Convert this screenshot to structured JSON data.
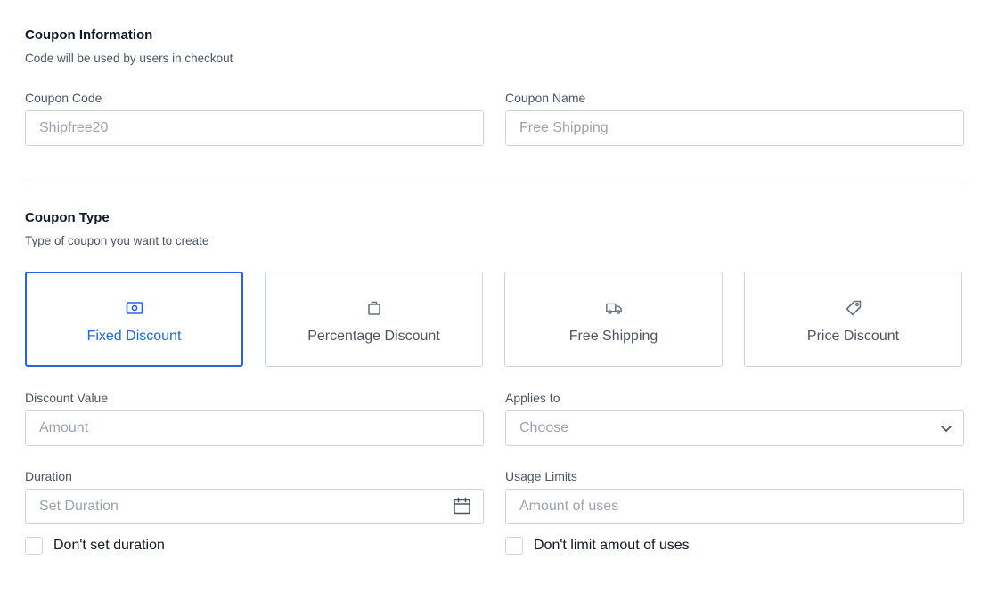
{
  "coupon_info": {
    "title": "Coupon Information",
    "subtitle": "Code will be used by users in checkout",
    "code": {
      "label": "Coupon Code",
      "placeholder": "Shipfree20",
      "value": ""
    },
    "name": {
      "label": "Coupon Name",
      "placeholder": "Free Shipping",
      "value": ""
    }
  },
  "coupon_type": {
    "title": "Coupon Type",
    "subtitle": "Type of coupon you want to create",
    "selected": "Fixed Discount",
    "options": [
      {
        "label": "Fixed Discount",
        "icon": "cash-icon"
      },
      {
        "label": "Percentage Discount",
        "icon": "bag-icon"
      },
      {
        "label": "Free Shipping",
        "icon": "truck-icon"
      },
      {
        "label": "Price Discount",
        "icon": "tag-icon"
      }
    ]
  },
  "discount_value": {
    "label": "Discount Value",
    "placeholder": "Amount"
  },
  "applies_to": {
    "label": "Applies to",
    "placeholder": "Choose"
  },
  "duration": {
    "label": "Duration",
    "placeholder": "Set Duration",
    "checkbox_label": "Don't set duration",
    "checked": false
  },
  "usage_limits": {
    "label": "Usage Limits",
    "placeholder": "Amount of uses",
    "checkbox_label": "Don't limit amout of uses",
    "checked": false
  },
  "colors": {
    "accent": "#2563eb",
    "border": "#d1d5db",
    "placeholder": "#9ca3af",
    "muted_text": "#4b5563"
  }
}
